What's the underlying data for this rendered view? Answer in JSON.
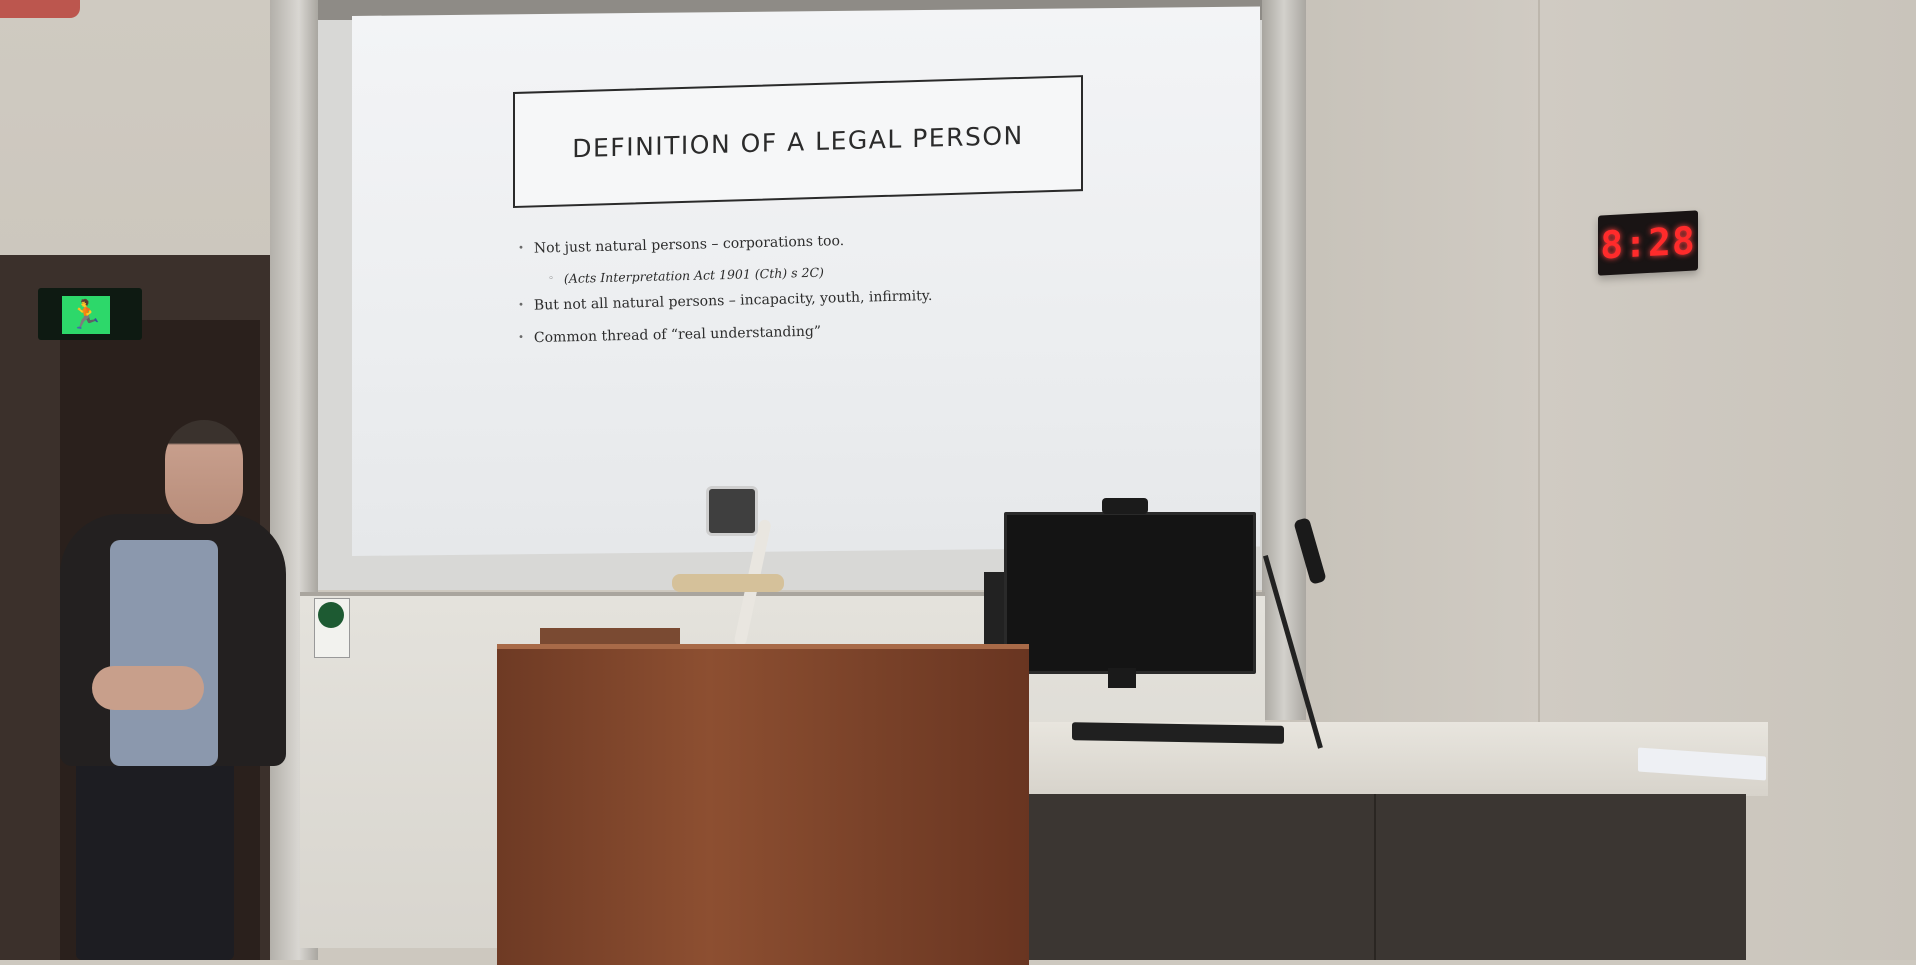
{
  "slide": {
    "title": "DEFINITION OF A LEGAL PERSON",
    "bullets": [
      {
        "text": "Not just natural persons – corporations too."
      },
      {
        "text": "(Acts Interpretation Act 1901 (Cth) s 2C)"
      },
      {
        "text": "But not all natural persons – incapacity, youth, infirmity."
      },
      {
        "text": "Common thread of “real understanding”"
      }
    ],
    "bullet_marker": "•",
    "sub_bullet_marker": "◦"
  },
  "clock": {
    "display": "8:28"
  },
  "exit_sign": {
    "icon": "running-man-icon",
    "glyph": "🏃"
  },
  "colors": {
    "clock_digit": "#ff2b2b",
    "exit_sign": "#2dd86a",
    "lectern": "#8d4f31"
  }
}
